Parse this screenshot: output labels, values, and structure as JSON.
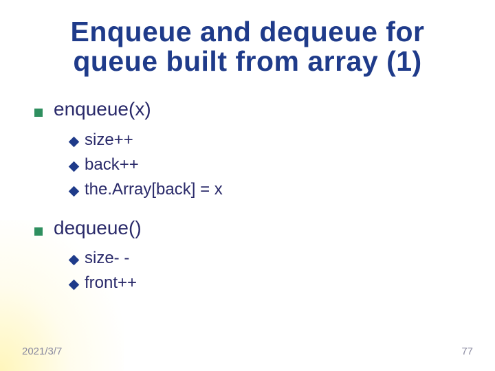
{
  "title": "Enqueue and dequeue for queue built from array (1)",
  "items": [
    {
      "label": "enqueue(x)",
      "sub": [
        "size++",
        "back++",
        "the.Array[back] = x"
      ]
    },
    {
      "label": "dequeue()",
      "sub": [
        "size- -",
        "front++"
      ]
    }
  ],
  "footer": {
    "date": "2021/3/7",
    "page": "77"
  }
}
